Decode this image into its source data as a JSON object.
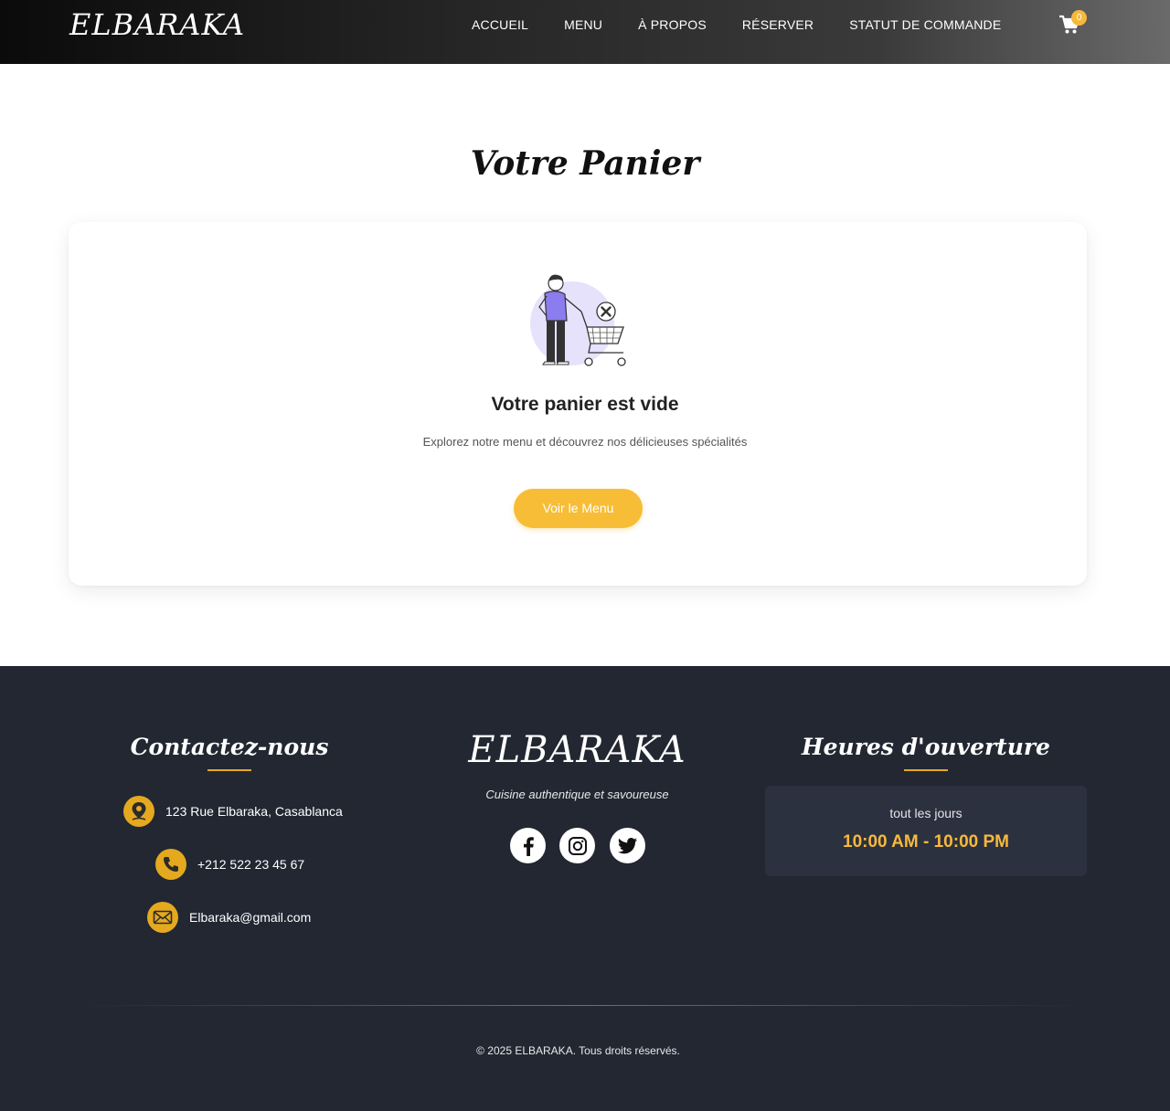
{
  "navbar": {
    "brand": "ELBARAKA",
    "links": [
      "ACCUEIL",
      "MENU",
      "À PROPOS",
      "RÉSERVER",
      "STATUT DE COMMANDE"
    ],
    "cart_icon": "shopping-cart-icon",
    "cart_count": "0"
  },
  "main": {
    "title": "Votre Panier",
    "illustration": "empty-cart-illustration",
    "empty_title": "Votre panier est vide",
    "empty_subtitle": "Explorez notre menu et découvrez nos délicieuses spécialités",
    "button_label": "Voir le Menu"
  },
  "footer": {
    "contact": {
      "heading": "Contactez-nous",
      "address": "123 Rue Elbaraka, Casablanca",
      "phone": "+212 522 23 45 67",
      "email": "Elbaraka@gmail.com"
    },
    "brand": "ELBARAKA",
    "tagline": "Cuisine authentique et savoureuse",
    "social": [
      "facebook-icon",
      "instagram-icon",
      "twitter-icon"
    ],
    "hours": {
      "heading": "Heures d'ouverture",
      "days": "tout les jours",
      "time": "10:00 AM - 10:00 PM"
    },
    "copyright": "© 2025 ELBARAKA. Tous droits réservés."
  },
  "colors": {
    "accent": "#f7bd36",
    "footer_bg": "#222732",
    "hours_box_bg": "#2c3140",
    "illustration_purple": "#8b7cf0"
  }
}
